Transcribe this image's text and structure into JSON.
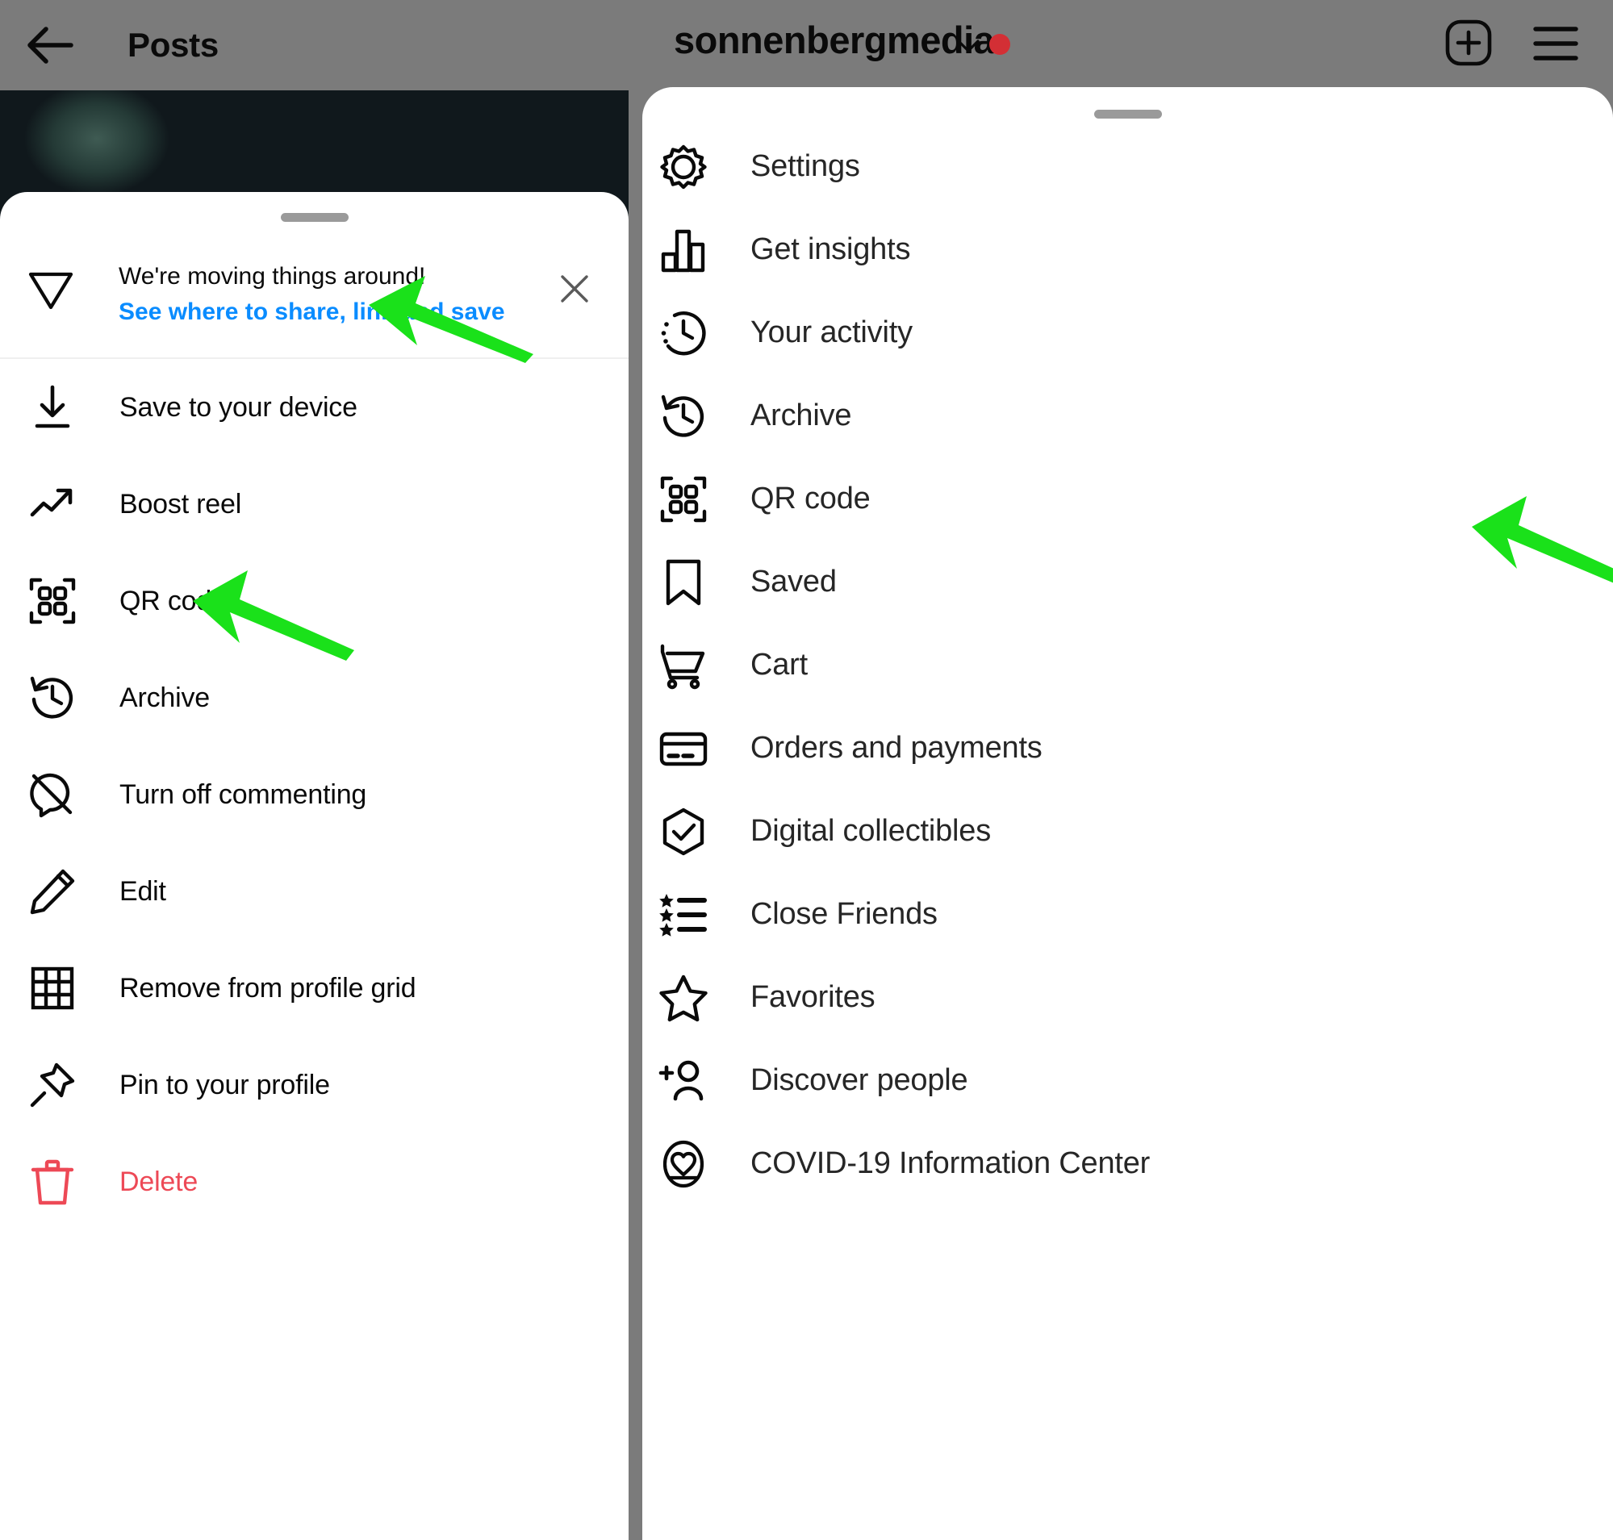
{
  "left_phone": {
    "header": {
      "back_icon": "back-arrow-icon",
      "title": "Posts"
    },
    "sheet": {
      "banner": {
        "icon": "share-paper-plane-icon",
        "line1": "We're moving things around!",
        "line2": "See where to share, link and save",
        "close_icon": "close-icon"
      },
      "items": [
        {
          "icon": "download-icon",
          "label": "Save to your device"
        },
        {
          "icon": "trending-up-icon",
          "label": "Boost reel"
        },
        {
          "icon": "qr-code-icon",
          "label": "QR code"
        },
        {
          "icon": "archive-clock-icon",
          "label": "Archive"
        },
        {
          "icon": "comment-off-icon",
          "label": "Turn off commenting"
        },
        {
          "icon": "pencil-edit-icon",
          "label": "Edit"
        },
        {
          "icon": "grid-icon",
          "label": "Remove from profile grid"
        },
        {
          "icon": "pin-icon",
          "label": "Pin to your profile"
        },
        {
          "icon": "trash-icon",
          "label": "Delete",
          "danger": true
        }
      ]
    }
  },
  "right_phone": {
    "header": {
      "username": "sonnenbergmedia",
      "chevron_icon": "chevron-down-icon",
      "badge_dot_color": "#d32f35",
      "new_post_icon": "plus-square-icon",
      "menu_icon": "hamburger-menu-icon"
    },
    "sheet": {
      "items": [
        {
          "icon": "gear-icon",
          "label": "Settings"
        },
        {
          "icon": "bar-chart-icon",
          "label": "Get insights"
        },
        {
          "icon": "activity-clock-icon",
          "label": "Your activity"
        },
        {
          "icon": "archive-clock-icon",
          "label": "Archive"
        },
        {
          "icon": "qr-code-icon",
          "label": "QR code"
        },
        {
          "icon": "bookmark-icon",
          "label": "Saved"
        },
        {
          "icon": "cart-icon",
          "label": "Cart"
        },
        {
          "icon": "credit-card-icon",
          "label": "Orders and payments"
        },
        {
          "icon": "shield-check-icon",
          "label": "Digital collectibles"
        },
        {
          "icon": "star-list-icon",
          "label": "Close Friends"
        },
        {
          "icon": "star-icon",
          "label": "Favorites"
        },
        {
          "icon": "add-person-icon",
          "label": "Discover people"
        },
        {
          "icon": "covid-heart-icon",
          "label": "COVID-19 Information Center"
        }
      ]
    }
  },
  "annotations": {
    "arrow_color": "#1ae11a",
    "arrows": [
      {
        "name": "arrow-to-banner-link",
        "points_at": "See where to share, link and save"
      },
      {
        "name": "arrow-to-qr-code-left",
        "points_at": "QR code"
      },
      {
        "name": "arrow-to-qr-code-right",
        "points_at": "QR code"
      }
    ]
  },
  "colors": {
    "scrim": "#7b7b7b",
    "sheet": "#ffffff",
    "link": "#0a8cff",
    "danger": "#ed4956",
    "text": "#0a0a0a"
  }
}
